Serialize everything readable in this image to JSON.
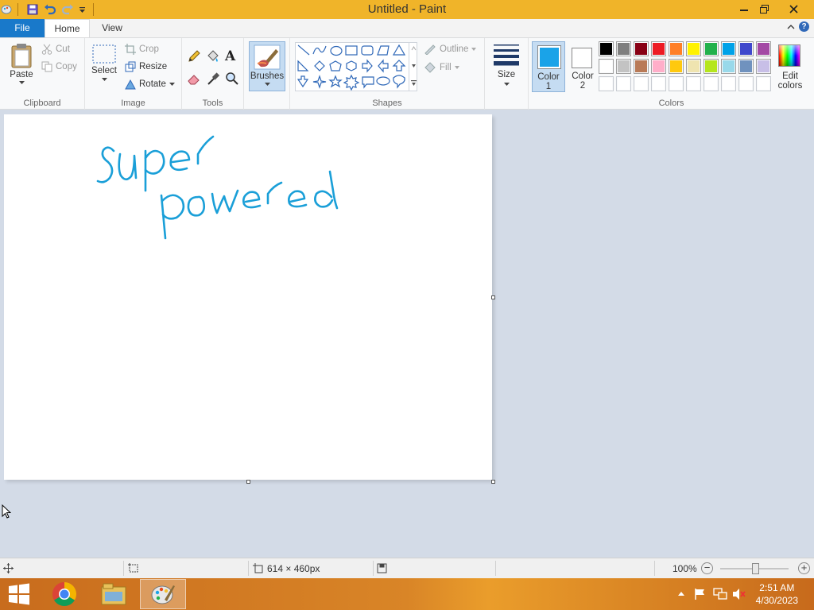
{
  "window": {
    "title": "Untitled - Paint"
  },
  "tabs": [
    {
      "label": "File"
    },
    {
      "label": "Home"
    },
    {
      "label": "View"
    }
  ],
  "clipboard": {
    "paste": "Paste",
    "cut": "Cut",
    "copy": "Copy",
    "group": "Clipboard"
  },
  "image": {
    "select": "Select",
    "crop": "Crop",
    "resize": "Resize",
    "rotate": "Rotate",
    "group": "Image"
  },
  "tools": {
    "group": "Tools",
    "text_glyph": "A"
  },
  "brushes": {
    "label": "Brushes"
  },
  "shapes": {
    "outline": "Outline",
    "fill": "Fill",
    "group": "Shapes"
  },
  "size": {
    "label": "Size"
  },
  "colors": {
    "color1_label": "Color",
    "color1_num": "1",
    "color2_label": "Color",
    "color2_num": "2",
    "edit_label": "Edit",
    "edit_label2": "colors",
    "group": "Colors",
    "color1": "#1aa3e8",
    "color2": "#ffffff",
    "palette": [
      [
        "#000000",
        "#7f7f7f",
        "#880015",
        "#ed1c24",
        "#ff7f27",
        "#fff200",
        "#22b14c",
        "#00a2e8",
        "#3f48cc",
        "#a349a4"
      ],
      [
        "#ffffff",
        "#c3c3c3",
        "#b97a57",
        "#ffaec9",
        "#ffc90e",
        "#efe4b0",
        "#b5e61d",
        "#99d9ea",
        "#7092be",
        "#c8bfe7"
      ],
      [
        "#ffffff",
        "#ffffff",
        "#ffffff",
        "#ffffff",
        "#ffffff",
        "#ffffff",
        "#ffffff",
        "#ffffff",
        "#ffffff",
        "#ffffff"
      ]
    ]
  },
  "canvas": {
    "ink_color": "#1a9fd8"
  },
  "status": {
    "dimensions": "614 × 460px",
    "zoom": "100%"
  },
  "taskbar": {
    "time": "2:51 AM",
    "date": "4/30/2023"
  }
}
